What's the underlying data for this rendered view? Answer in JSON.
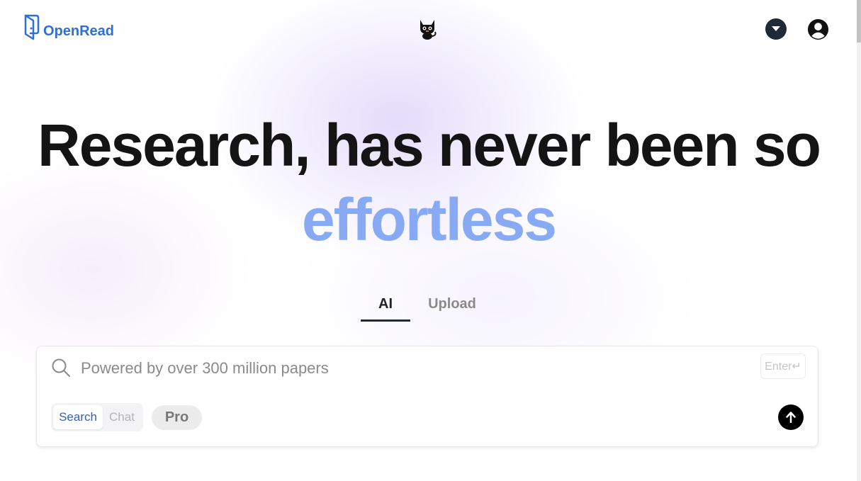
{
  "header": {
    "logo_text": "OpenRead",
    "logo_icon": "door-book-icon",
    "mascot_icon": "cat-icon",
    "dropdown_icon": "caret-down-icon",
    "avatar_icon": "user-avatar-icon"
  },
  "hero": {
    "line1": "Research, has never been so",
    "line2": "effortless"
  },
  "tabs": [
    {
      "label": "AI",
      "active": true
    },
    {
      "label": "Upload",
      "active": false
    }
  ],
  "search": {
    "placeholder": "Powered by over 300 million papers",
    "value": "",
    "enter_hint": "Enter↵",
    "modes": [
      {
        "label": "Search",
        "active": true
      },
      {
        "label": "Chat",
        "active": false
      }
    ],
    "pro_label": "Pro",
    "submit_icon": "arrow-up-icon"
  },
  "colors": {
    "brand": "#2f6fd6",
    "accent_text": "#88aaf5",
    "heading": "#141414",
    "tab_underline": "#1e2a3a"
  }
}
